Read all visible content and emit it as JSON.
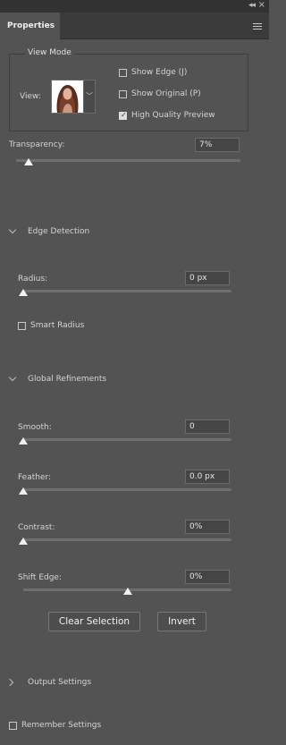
{
  "panel": {
    "tab_label": "Properties"
  },
  "view_mode": {
    "title": "View Mode",
    "view_label": "View:",
    "options": [
      {
        "label": "Show Edge (J)",
        "checked": false
      },
      {
        "label": "Show Original (P)",
        "checked": false
      },
      {
        "label": "High Quality Preview",
        "checked": true
      }
    ]
  },
  "transparency": {
    "label": "Transparency:",
    "value": "7%",
    "level_percent": 7
  },
  "edge_detection": {
    "title": "Edge Detection",
    "radius": {
      "label": "Radius:",
      "value": "0 px",
      "level_percent": 0
    },
    "smart_radius": {
      "label": "Smart Radius",
      "checked": false
    }
  },
  "global_refinements": {
    "title": "Global Refinements",
    "smooth": {
      "label": "Smooth:",
      "value": "0",
      "level_percent": 0
    },
    "feather": {
      "label": "Feather:",
      "value": "0.0 px",
      "level_percent": 0
    },
    "contrast": {
      "label": "Contrast:",
      "value": "0%",
      "level_percent": 0
    },
    "shift_edge": {
      "label": "Shift Edge:",
      "value": "0%",
      "level_percent": 50
    }
  },
  "buttons": {
    "clear_selection": "Clear Selection",
    "invert": "Invert"
  },
  "output_settings": {
    "title": "Output Settings"
  },
  "remember_settings": {
    "label": "Remember Settings",
    "checked": false
  },
  "icons": {
    "collapse": "double-chevron-left-icon",
    "close": "close-icon",
    "panel_menu": "hamburger-menu-icon",
    "section_expanded": "chevron-down-icon",
    "section_collapsed": "chevron-right-icon",
    "checkbox_checked": "check-icon"
  }
}
